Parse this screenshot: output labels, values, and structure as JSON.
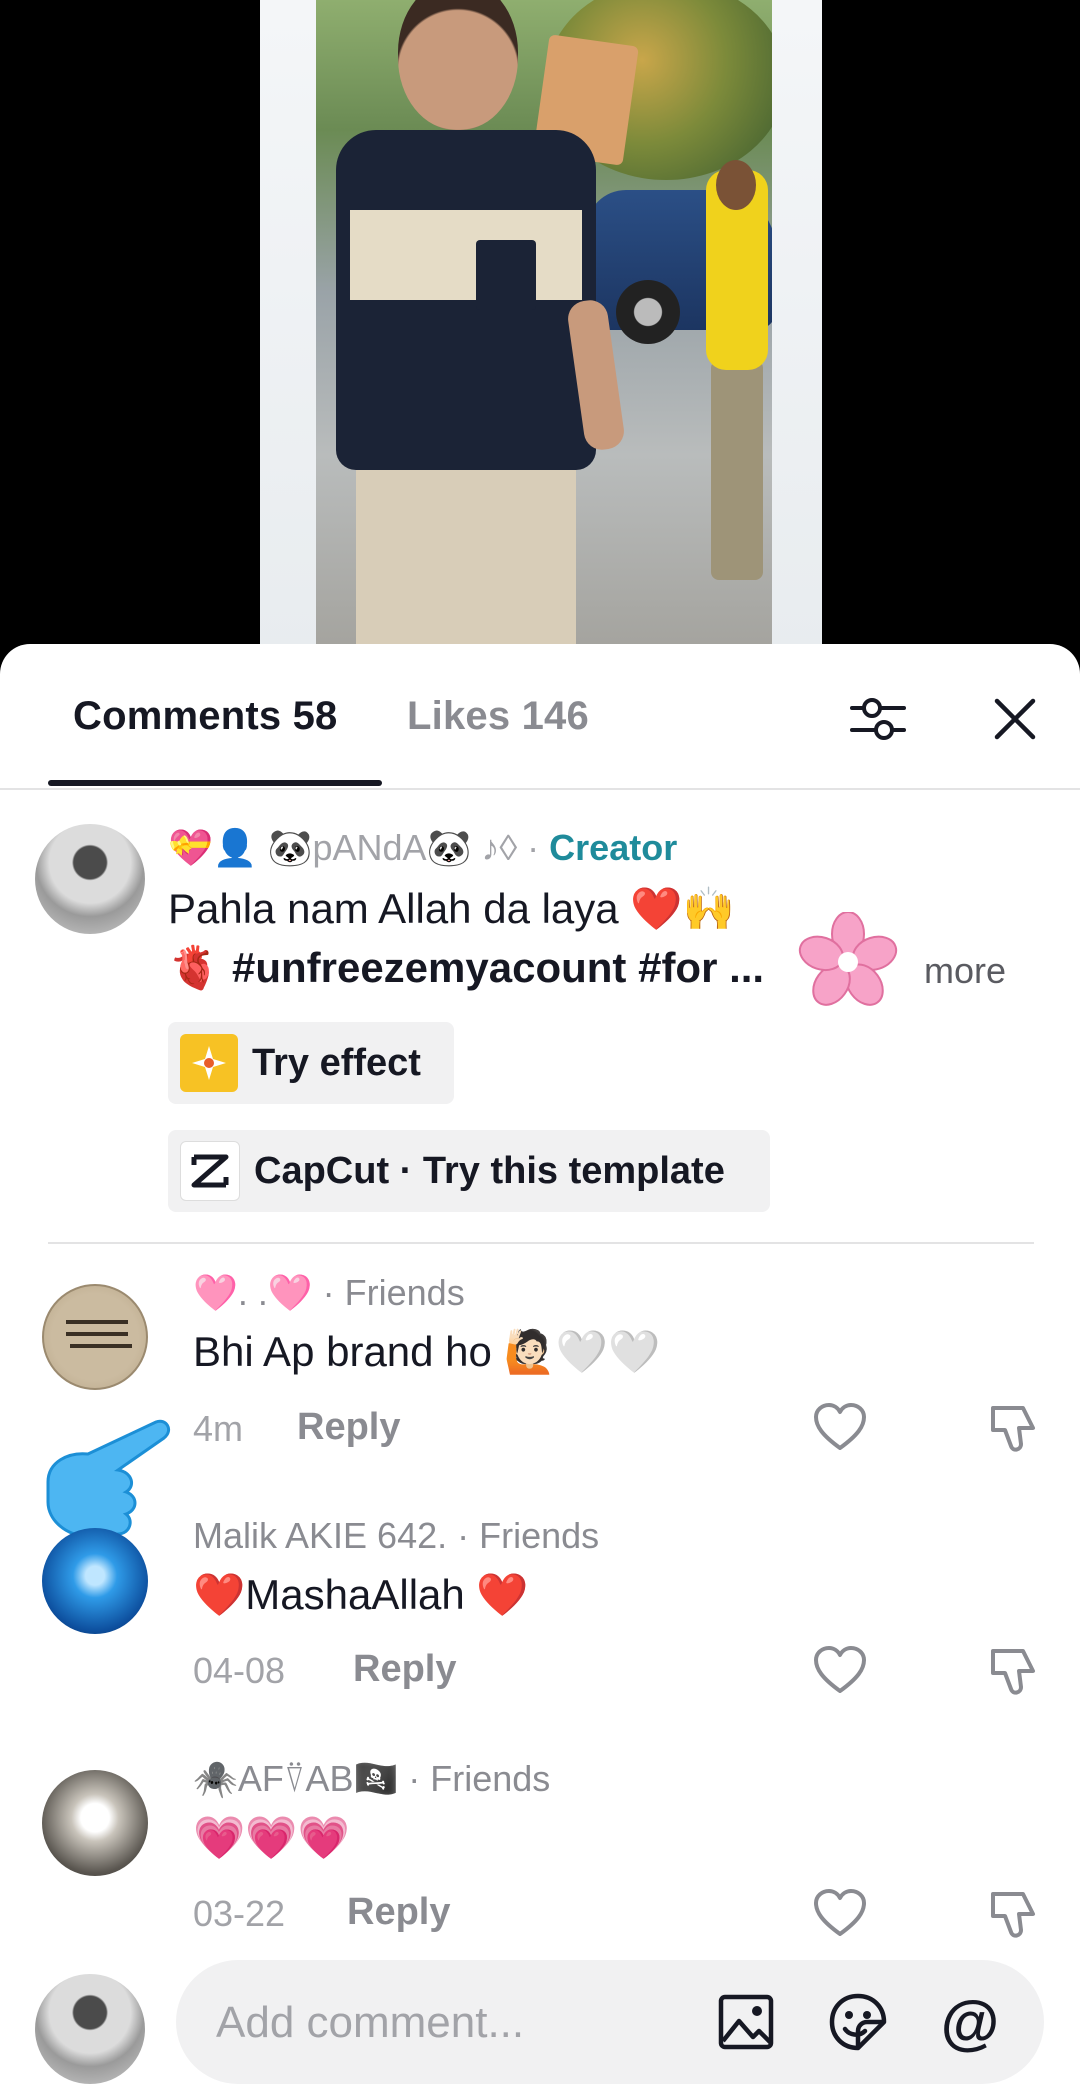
{
  "tabs": {
    "comments_label": "Comments 58",
    "likes_label": "Likes 146"
  },
  "creator_comment": {
    "username_prefix": "💝👤 🐼pANdA🐼 ♪◊ ·",
    "creator_tag": "Creator",
    "text_line1": "Pahla nam Allah da laya ❤️🙌",
    "text_line2": "🫀 #unfreezemyacount #for ...",
    "more_label": "more",
    "effect_chip": "Try effect",
    "capcut_chip": "CapCut · Try this template"
  },
  "comments": [
    {
      "username": "🩷.              .🩷 · Friends",
      "text": "Bhi Ap brand ho 🙋🏻🤍🤍",
      "time": "4m",
      "reply_label": "Reply"
    },
    {
      "username": "Malik AKIE 642. · Friends",
      "text": "❤️MashaAllah ❤️",
      "time": "04-08",
      "reply_label": "Reply"
    },
    {
      "username": "🕷️AF⍢AB🏴‍☠️ · Friends",
      "text": "💗💗💗",
      "time": "03-22",
      "reply_label": "Reply"
    }
  ],
  "input": {
    "placeholder": "Add comment..."
  },
  "colors": {
    "creator_tag": "#1f8b9b",
    "text_primary": "#161823",
    "text_secondary": "#8a8b91",
    "chip_bg": "#f1f1f2"
  }
}
